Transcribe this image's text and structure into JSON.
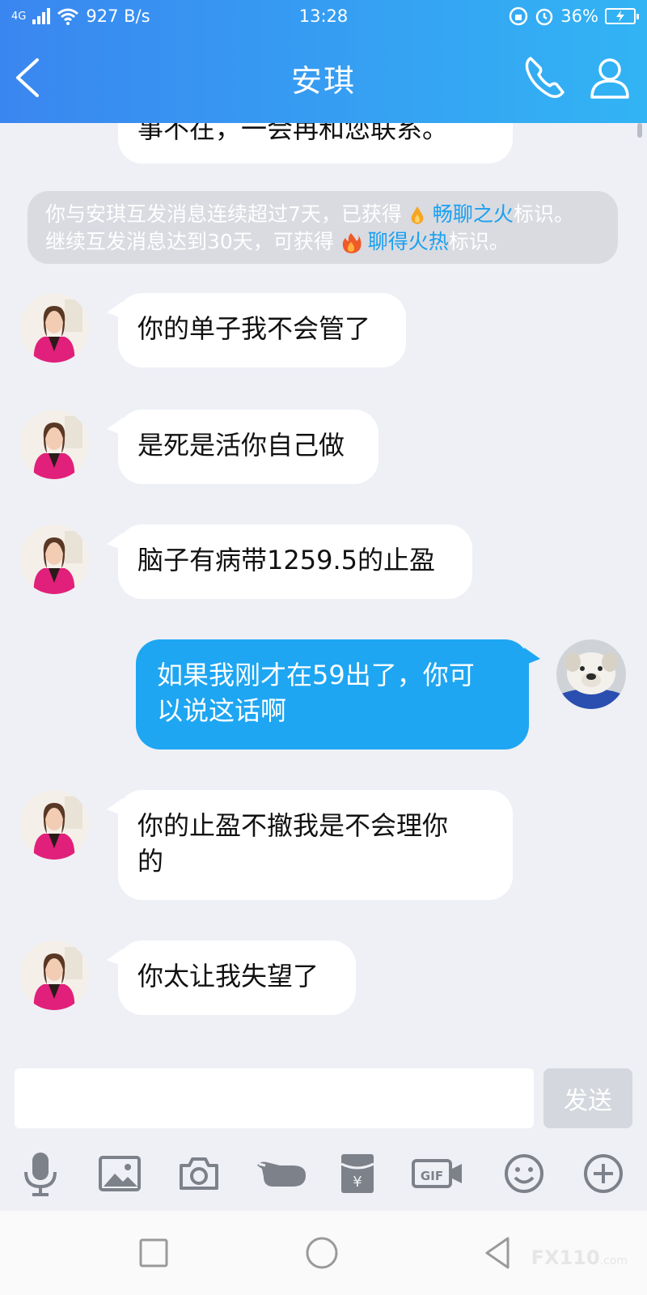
{
  "status_bar": {
    "signal": "4G",
    "speed": "927 B/s",
    "time": "13:28",
    "battery": "36%"
  },
  "nav": {
    "title": "安琪"
  },
  "messages": {
    "partial": "事不在，一会再和您联系。",
    "system_line1_a": "你与安琪互发消息连续超过7天，已获得",
    "system_line1_link": "畅聊之火",
    "system_line1_b": "标识。",
    "system_line2_a": "继续互发消息达到30天，可获得",
    "system_line2_link": "聊得火热",
    "system_line2_b": "标识。",
    "m1": "你的单子我不会管了",
    "m2": "是死是活你自己做",
    "m3": "脑子有病带1259.5的止盈",
    "m4_line1": "如果我刚才在59出了，你可",
    "m4_line2": "以说这话啊",
    "m5_line1": "你的止盈不撤我是不会理你",
    "m5_line2": "的",
    "m6": "你太让我失望了"
  },
  "input": {
    "send_label": "发送"
  },
  "watermark": {
    "brand": "FX110",
    "suffix": ".com"
  },
  "colors": {
    "header_gradient_start": "#3a86f0",
    "header_gradient_end": "#32b4f4",
    "my_bubble": "#1ea6f2",
    "link": "#1aa0f0"
  }
}
